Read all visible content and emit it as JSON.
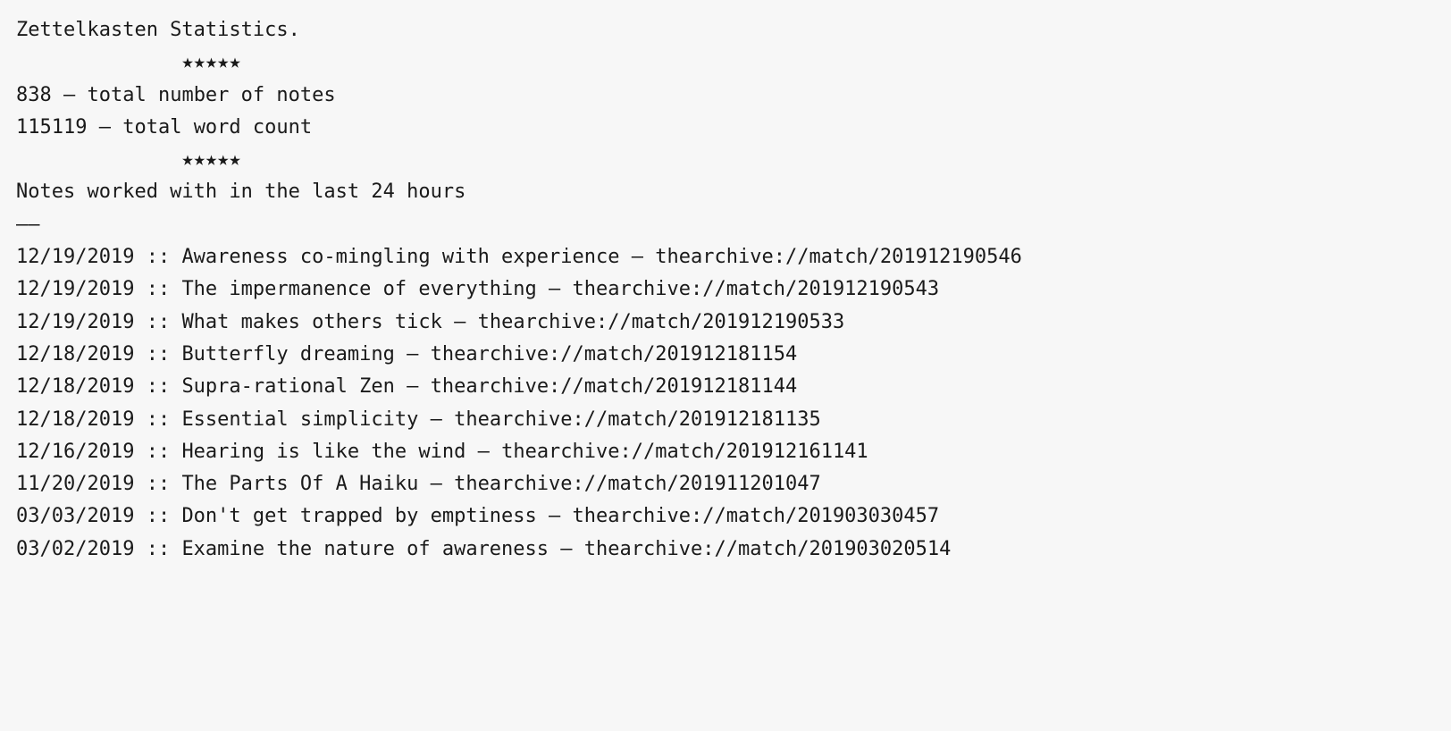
{
  "header": {
    "title": "Zettelkasten Statistics.",
    "divider": "★★★★★"
  },
  "stats": {
    "note_count": "838",
    "note_count_label": " — total number of notes",
    "word_count": "115119",
    "word_count_label": " — total word count"
  },
  "recent": {
    "heading": "Notes worked with in the last 24 hours",
    "rule": "——",
    "entries": [
      {
        "date": "12/19/2019",
        "sep": " :: ",
        "title": "Awareness co-mingling with experience",
        "dash": "  — ",
        "url": "thearchive://match/201912190546"
      },
      {
        "date": "12/19/2019",
        "sep": " :: ",
        "title": "The impermanence of everything",
        "dash": "  — ",
        "url": "thearchive://match/201912190543"
      },
      {
        "date": "12/19/2019",
        "sep": " :: ",
        "title": "What makes others tick",
        "dash": "  — ",
        "url": "thearchive://match/201912190533"
      },
      {
        "date": "12/18/2019",
        "sep": " :: ",
        "title": "Butterfly dreaming",
        "dash": "  — ",
        "url": "thearchive://match/201912181154"
      },
      {
        "date": "12/18/2019",
        "sep": " :: ",
        "title": "Supra-rational Zen",
        "dash": "  — ",
        "url": "thearchive://match/201912181144"
      },
      {
        "date": "12/18/2019",
        "sep": " :: ",
        "title": "Essential simplicity",
        "dash": "  — ",
        "url": "thearchive://match/201912181135"
      },
      {
        "date": "12/16/2019",
        "sep": " :: ",
        "title": "Hearing is like the wind",
        "dash": "  — ",
        "url": "thearchive://match/201912161141"
      },
      {
        "date": "11/20/2019",
        "sep": " :: ",
        "title": "The Parts Of A Haiku",
        "dash": "  — ",
        "url": "thearchive://match/201911201047"
      },
      {
        "date": "03/03/2019",
        "sep": " :: ",
        "title": "Don't get trapped by emptiness",
        "dash": "  — ",
        "url": "thearchive://match/201903030457"
      },
      {
        "date": "03/02/2019",
        "sep": " :: ",
        "title": "Examine the nature of awareness",
        "dash": "  — ",
        "url": "thearchive://match/201903020514"
      }
    ]
  }
}
